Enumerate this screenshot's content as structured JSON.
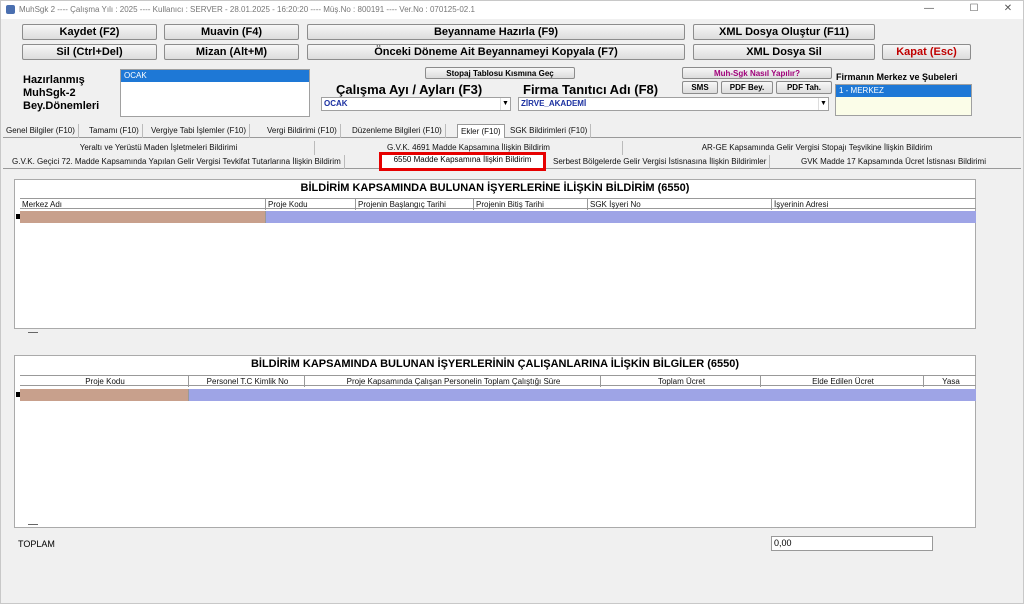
{
  "title": "MuhSgk 2  ----  Çalışma Yılı : 2025  ----  Kullanıcı : SERVER - 28.01.2025 - 16:20:20  ----  Müş.No : 800191  ----  Ver.No : 070125-02.1",
  "toolbar": {
    "kaydet": "Kaydet (F2)",
    "muavin": "Muavin (F4)",
    "beyanname": "Beyanname Hazırla (F9)",
    "xml_olustur": "XML Dosya Oluştur (F11)",
    "sil": "Sil (Ctrl+Del)",
    "mizan": "Mizan (Alt+M)",
    "onceki": "Önceki Döneme Ait Beyannameyi Kopyala (F7)",
    "xml_sil": "XML Dosya Sil",
    "kapat": "Kapat (Esc)"
  },
  "left_label": {
    "line1": "Hazırlanmış",
    "line2": "MuhSgk-2",
    "line3": "Bey.Dönemleri"
  },
  "period_list": {
    "selected": "OCAK"
  },
  "stopaj_button": "Stopaj Tablosu Kısmına Geç",
  "calisma_ayi": {
    "label": "Çalışma Ayı / Ayları (F3)",
    "value": "OCAK"
  },
  "firma": {
    "label": "Firma Tanıtıcı Adı (F8)",
    "value": "ZİRVE_AKADEMİ"
  },
  "help_button": "Muh-Sgk Nasıl Yapılır?",
  "sms_button": "SMS",
  "pdf_bey_button": "PDF Bey.",
  "pdf_tah_button": "PDF Tah.",
  "sube": {
    "label": "Firmanın Merkez ve Şubeleri",
    "selected": "1 - MERKEZ"
  },
  "tabs_row1": [
    "Genel Bilgiler (F10)",
    "Tamamı (F10)",
    "Vergiye Tabi İşlemler (F10)",
    "Vergi Bildirimi (F10)",
    "Düzenleme Bilgileri (F10)",
    "Ekler (F10)",
    "SGK Bildirimleri (F10)"
  ],
  "tabs_row2": [
    "Yeraltı ve Yerüstü Maden İşletmeleri Bildirimi",
    "G.V.K. 4691 Madde Kapsamına İlişkin Bildirim",
    "AR-GE Kapsamında Gelir Vergisi Stopajı Teşvikine İlişkin Bildirim"
  ],
  "tabs_row3": [
    "G.V.K. Geçici 72. Madde Kapsamında Yapılan Gelir Vergisi Tevkifat Tutarlarına İlişkin Bildirim",
    "6550 Madde Kapsamına İlişkin Bildirim",
    "Serbest Bölgelerde Gelir Vergisi İstisnasına İlişkin Bildirimler",
    "GVK Madde 17 Kapsamında Ücret İstisnası Bildirimi"
  ],
  "grid1": {
    "title": "BİLDİRİM KAPSAMINDA BULUNAN İŞYERLERİNE İLİŞKİN BİLDİRİM (6550)",
    "columns": [
      "Merkez Adı",
      "Proje Kodu",
      "Projenin Başlangıç Tarihi",
      "Projenin Bitiş Tarihi",
      "SGK İşyeri No",
      "İşyerinin Adresi"
    ]
  },
  "grid2": {
    "title": "BİLDİRİM KAPSAMINDA BULUNAN İŞYERLERİNİN ÇALIŞANLARINA İLİŞKİN BİLGİLER (6550)",
    "columns": [
      "Proje Kodu",
      "Personel T.C Kimlik No",
      "Proje Kapsamında Çalışan Personelin Toplam Çalıştığı Süre",
      "Toplam Ücret",
      "Elde Edilen Ücret",
      "Yasa"
    ]
  },
  "toplam": {
    "label": "TOPLAM",
    "value": "0,00"
  },
  "colors": {
    "selected_row_first": "#c8a08c",
    "selected_row_rest": "#9ea4e6",
    "highlight": "#e60000",
    "accent": "#1e78d6"
  }
}
